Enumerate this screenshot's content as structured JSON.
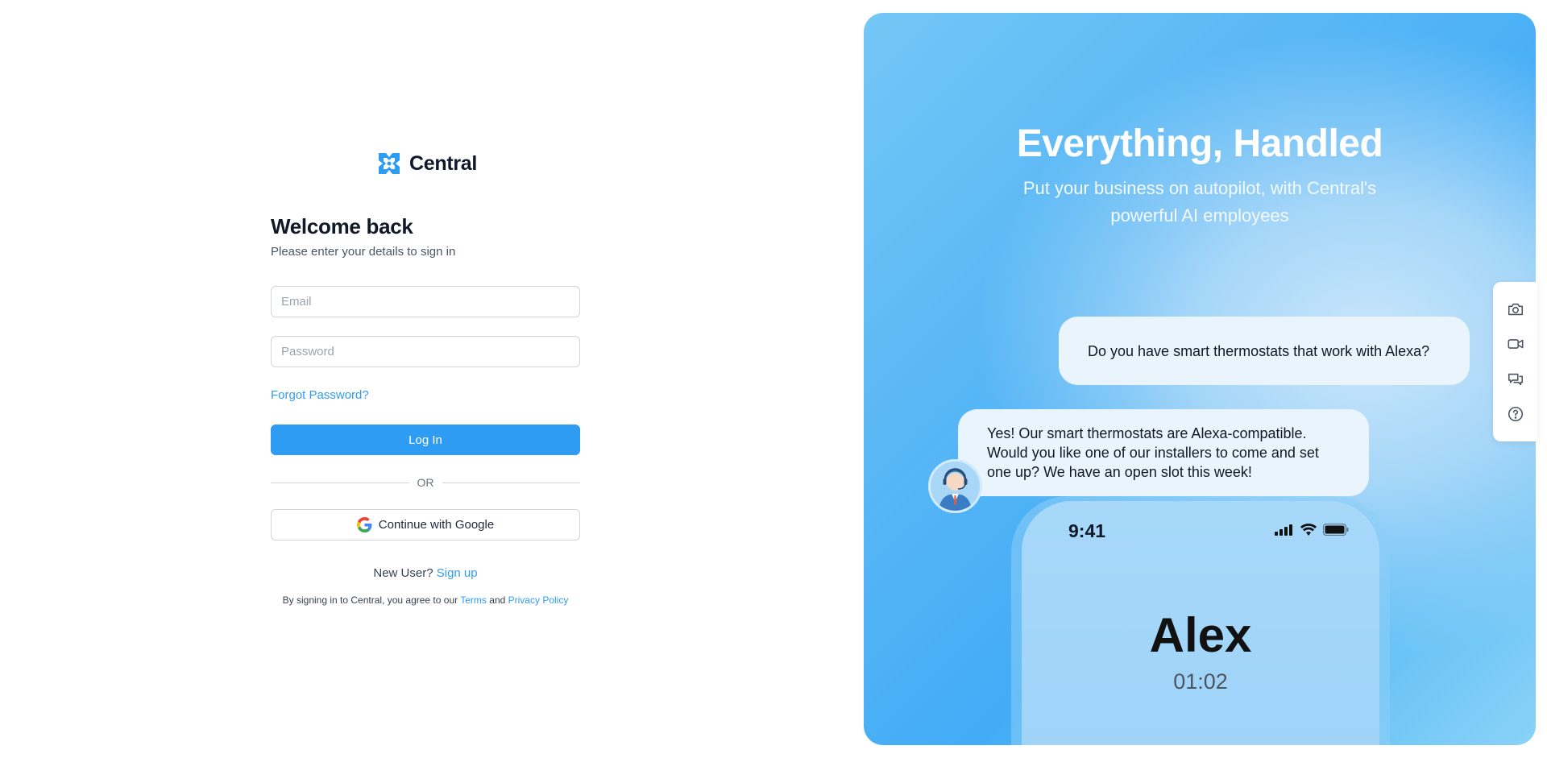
{
  "brand": {
    "name": "Central"
  },
  "login": {
    "heading": "Welcome back",
    "subtitle": "Please enter your details to sign in",
    "email_placeholder": "Email",
    "email_value": "",
    "password_placeholder": "Password",
    "password_value": "",
    "forgot_label": "Forgot Password?",
    "login_label": "Log In",
    "or_label": "OR",
    "google_label": "Continue with Google",
    "new_user_text": "New User?",
    "signup_label": "Sign up",
    "terms_prefix": "By signing in to Central, you agree to our",
    "terms_link": "Terms",
    "terms_and": "and",
    "privacy_link": "Privacy Policy"
  },
  "hero": {
    "title": "Everything, Handled",
    "subtitle": "Put your business on autopilot, with Central's powerful AI employees",
    "question": "Do you have smart thermostats that work with Alexa?",
    "answer": "Yes! Our smart thermostats are Alexa-compatible. Would you like one of our installers to come and set one up? We have an open slot this week!",
    "phone_time": "9:41",
    "caller_name": "Alex",
    "call_duration": "01:02"
  },
  "toolbar": {
    "icons": [
      "camera-icon",
      "video-icon",
      "chat-icon",
      "help-icon"
    ]
  },
  "colors": {
    "accent": "#2f9cf4",
    "hero_gradient_start": "#74c7f6",
    "hero_gradient_end": "#42acf7"
  }
}
